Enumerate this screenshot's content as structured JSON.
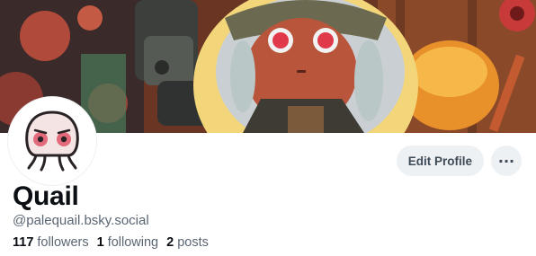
{
  "profile": {
    "display_name": "Quail",
    "handle": "@palequail.bsky.social",
    "stats": {
      "followers_count": "117",
      "followers_label": "followers",
      "following_count": "1",
      "following_label": "following",
      "posts_count": "2",
      "posts_label": "posts"
    }
  },
  "actions": {
    "edit_label": "Edit Profile",
    "more_label": "···"
  },
  "icons": {
    "avatar": "octopus-face-avatar",
    "more": "ellipsis-icon"
  },
  "colors": {
    "button_bg": "#eef1f4",
    "button_text": "#3f4a57",
    "secondary_text": "#5b6673",
    "primary_text": "#0b0f14"
  }
}
